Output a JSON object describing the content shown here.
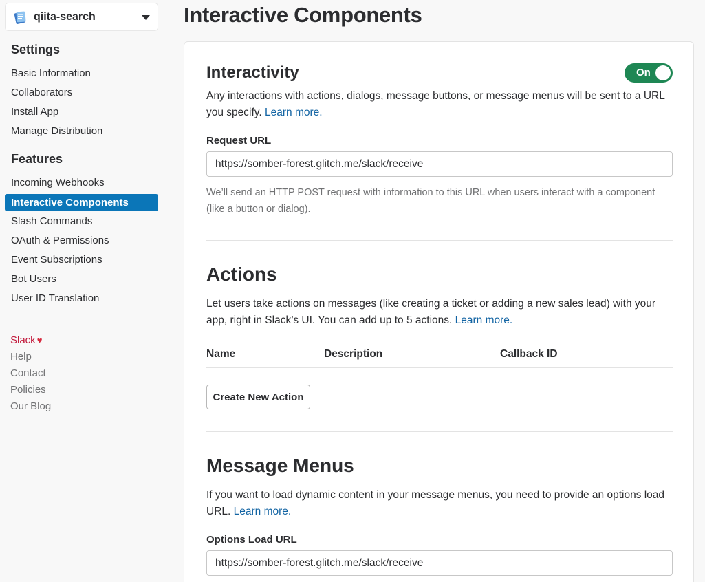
{
  "app": {
    "name": "qiita-search"
  },
  "sidebar": {
    "settings_heading": "Settings",
    "settings_items": [
      "Basic Information",
      "Collaborators",
      "Install App",
      "Manage Distribution"
    ],
    "features_heading": "Features",
    "features_items": [
      "Incoming Webhooks",
      "Interactive Components",
      "Slash Commands",
      "OAuth & Permissions",
      "Event Subscriptions",
      "Bot Users",
      "User ID Translation"
    ],
    "active_item": "Interactive Components",
    "footer": [
      "Slack",
      "Help",
      "Contact",
      "Policies",
      "Our Blog"
    ]
  },
  "page": {
    "title": "Interactive Components"
  },
  "interactivity": {
    "title": "Interactivity",
    "toggle_label": "On",
    "description": "Any interactions with actions, dialogs, message buttons, or message menus will be sent to a URL you specify.",
    "learn_more": "Learn more.",
    "request_url_label": "Request URL",
    "request_url_value": "https://somber-forest.glitch.me/slack/receive",
    "hint": "We’ll send an HTTP POST request with information to this URL when users interact with a component (like a button or dialog)."
  },
  "actions": {
    "title": "Actions",
    "description": "Let users take actions on messages (like creating a ticket or adding a new sales lead) with your app, right in Slack’s UI. You can add up to 5 actions.",
    "learn_more": "Learn more.",
    "columns": [
      "Name",
      "Description",
      "Callback ID"
    ],
    "create_button": "Create New Action"
  },
  "message_menus": {
    "title": "Message Menus",
    "description": "If you want to load dynamic content in your message menus, you need to provide an options load URL.",
    "learn_more": "Learn more.",
    "options_url_label": "Options Load URL",
    "options_url_value": "https://somber-forest.glitch.me/slack/receive"
  },
  "colors": {
    "accent": "#0b76b8",
    "toggle_on": "#1e8754",
    "link": "#1264a3"
  }
}
